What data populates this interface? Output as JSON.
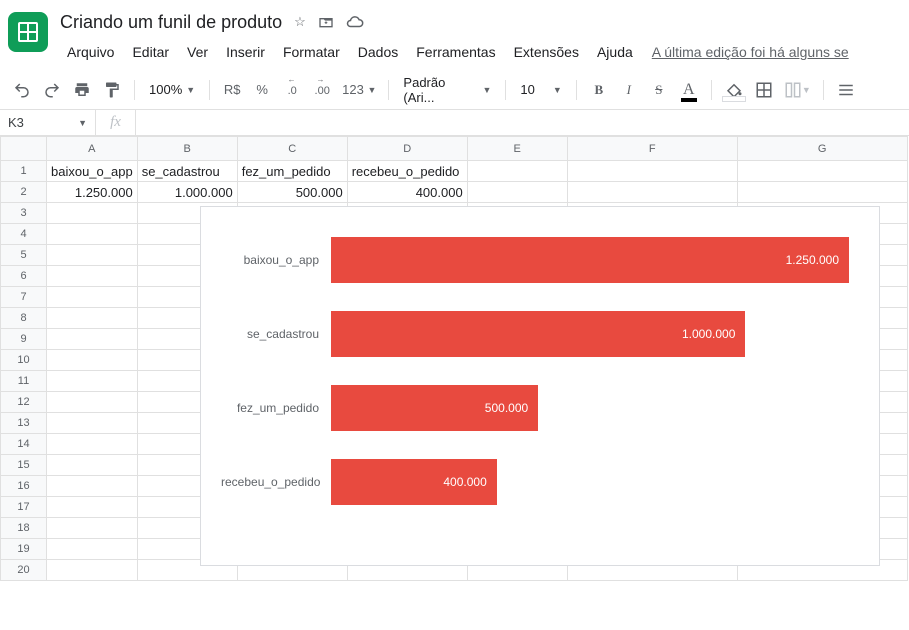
{
  "header": {
    "doc_title": "Criando um funil de produto",
    "menus": [
      "Arquivo",
      "Editar",
      "Ver",
      "Inserir",
      "Formatar",
      "Dados",
      "Ferramentas",
      "Extensões",
      "Ajuda"
    ],
    "last_edit": "A última edição foi há alguns se"
  },
  "toolbar": {
    "zoom": "100%",
    "currency": "R$",
    "percent": "%",
    "dec_dec": ".0",
    "inc_dec": ".00",
    "num_fmt": "123",
    "font": "Padrão (Ari...",
    "font_size": "10"
  },
  "fx": {
    "name_box": "K3",
    "fx_label": "fx",
    "formula": ""
  },
  "columns": [
    "A",
    "B",
    "C",
    "D",
    "E",
    "F",
    "G"
  ],
  "rows": [
    1,
    2,
    3,
    4,
    5,
    6,
    7,
    8,
    9,
    10,
    11,
    12,
    13,
    14,
    15,
    16,
    17,
    18,
    19,
    20
  ],
  "cells": {
    "A1": "baixou_o_app",
    "B1": "se_cadastrou",
    "C1": "fez_um_pedido",
    "D1": "recebeu_o_pedido",
    "A2": "1.250.000",
    "B2": "1.000.000",
    "C2": "500.000",
    "D2": "400.000"
  },
  "chart_data": {
    "type": "bar",
    "categories": [
      "baixou_o_app",
      "se_cadastrou",
      "fez_um_pedido",
      "recebeu_o_pedido"
    ],
    "values": [
      1250000,
      1000000,
      500000,
      400000
    ],
    "value_labels": [
      "1.250.000",
      "1.000.000",
      "500.000",
      "400.000"
    ],
    "xlim": [
      0,
      1250000
    ],
    "bar_color": "#e84a3f"
  }
}
